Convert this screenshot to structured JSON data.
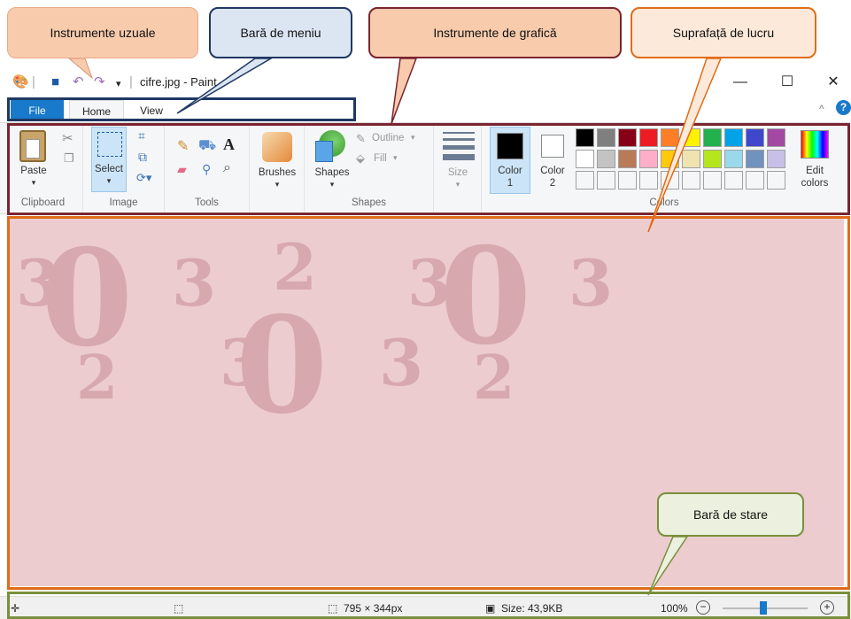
{
  "annotations": {
    "quick_access": "Instrumente uzuale",
    "menu_bar": "Bară de meniu",
    "graphics_tools": "Instrumente de grafică",
    "work_area": "Suprafață de lucru",
    "status_bar": "Bară de stare"
  },
  "window": {
    "title": "cifre.jpg - Paint",
    "minimize": "—",
    "maximize": "☐",
    "close": "✕"
  },
  "menu": {
    "file": "File",
    "home": "Home",
    "view": "View"
  },
  "ribbon": {
    "clipboard": {
      "paste": "Paste",
      "label": "Clipboard"
    },
    "image": {
      "select": "Select",
      "label": "Image"
    },
    "tools": {
      "label": "Tools"
    },
    "brushes": {
      "label": "Brushes"
    },
    "shapes": {
      "shapes": "Shapes",
      "outline": "Outline",
      "fill": "Fill",
      "label": "Shapes"
    },
    "size": {
      "label": "Size"
    },
    "colors": {
      "color1": "Color",
      "color1_num": "1",
      "color2": "Color",
      "color2_num": "2",
      "edit": "Edit",
      "edit2": "colors",
      "label": "Colors",
      "palette_row1": [
        "#000000",
        "#7f7f7f",
        "#880015",
        "#ed1c24",
        "#ff7f27",
        "#fff200",
        "#22b14c",
        "#00a2e8",
        "#3f48cc",
        "#a349a4"
      ],
      "palette_row2": [
        "#ffffff",
        "#c3c3c3",
        "#b97a57",
        "#ffaec9",
        "#ffc90e",
        "#efe4b0",
        "#b5e61d",
        "#99d9ea",
        "#7092be",
        "#c8bfe7"
      ]
    }
  },
  "status": {
    "dimensions": "795 × 344px",
    "size": "Size: 43,9KB",
    "zoom": "100%",
    "zoom_out": "−",
    "zoom_in": "+"
  }
}
